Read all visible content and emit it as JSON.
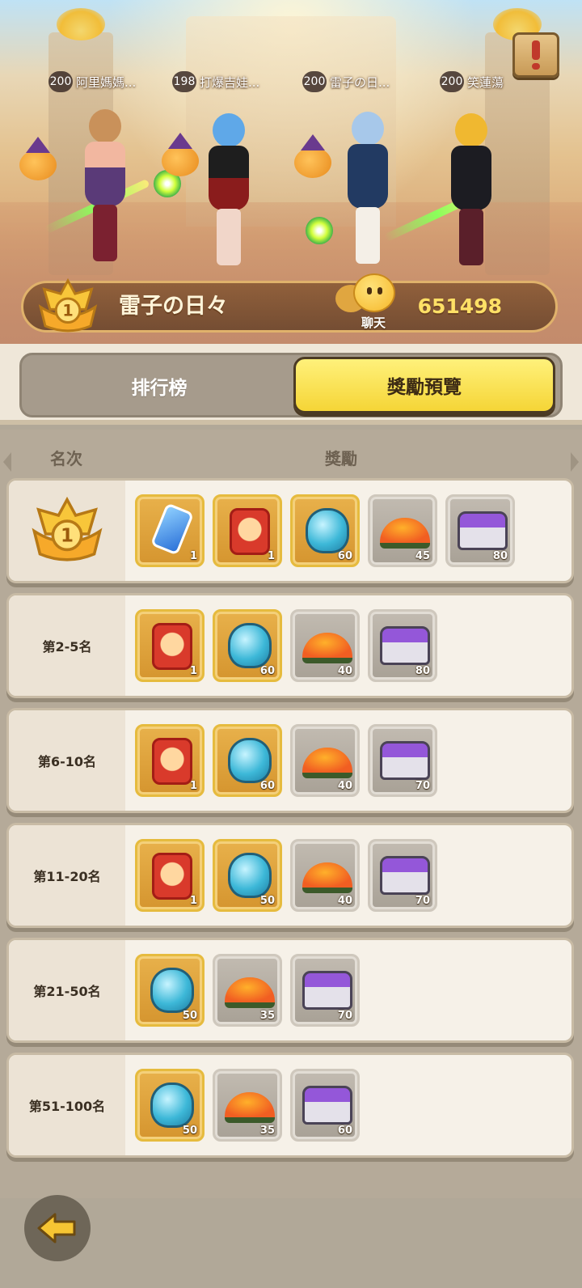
{
  "scene": {
    "players": [
      {
        "level": "200",
        "name": "阿里媽媽..."
      },
      {
        "level": "198",
        "name": "打爆吉娃..."
      },
      {
        "level": "200",
        "name": "雷子の日..."
      },
      {
        "level": "200",
        "name": "笑蓮蕩"
      }
    ],
    "champion": {
      "rank": "1",
      "name": "雷子の日々",
      "score": "651498"
    },
    "chat_label": "聊天"
  },
  "tabs": [
    {
      "label": "排行榜",
      "active": false
    },
    {
      "label": "獎勵預覽",
      "active": true
    }
  ],
  "list": {
    "col_rank": "名次",
    "col_reward": "獎勵",
    "rows": [
      {
        "rank": "1",
        "items": [
          {
            "icon": "ticket-tag-icon",
            "qty": "1",
            "frame": "gold"
          },
          {
            "icon": "red-card-icon",
            "qty": "1",
            "frame": "gold"
          },
          {
            "icon": "blue-potion-icon",
            "qty": "60",
            "frame": "gold"
          },
          {
            "icon": "food-plate-icon",
            "qty": "45",
            "frame": "grey"
          },
          {
            "icon": "purple-chest-icon",
            "qty": "80",
            "frame": "grey"
          }
        ]
      },
      {
        "rank": "第2-5名",
        "items": [
          {
            "icon": "red-card-icon",
            "qty": "1",
            "frame": "gold"
          },
          {
            "icon": "blue-potion-icon",
            "qty": "60",
            "frame": "gold"
          },
          {
            "icon": "food-plate-icon",
            "qty": "40",
            "frame": "grey"
          },
          {
            "icon": "purple-chest-icon",
            "qty": "80",
            "frame": "grey"
          }
        ]
      },
      {
        "rank": "第6-10名",
        "items": [
          {
            "icon": "red-card-icon",
            "qty": "1",
            "frame": "gold"
          },
          {
            "icon": "blue-potion-icon",
            "qty": "60",
            "frame": "gold"
          },
          {
            "icon": "food-plate-icon",
            "qty": "40",
            "frame": "grey"
          },
          {
            "icon": "purple-chest-icon",
            "qty": "70",
            "frame": "grey"
          }
        ]
      },
      {
        "rank": "第11-20名",
        "items": [
          {
            "icon": "red-card-icon",
            "qty": "1",
            "frame": "gold"
          },
          {
            "icon": "blue-potion-icon",
            "qty": "50",
            "frame": "gold"
          },
          {
            "icon": "food-plate-icon",
            "qty": "40",
            "frame": "grey"
          },
          {
            "icon": "purple-chest-icon",
            "qty": "70",
            "frame": "grey"
          }
        ]
      },
      {
        "rank": "第21-50名",
        "items": [
          {
            "icon": "blue-potion-icon",
            "qty": "50",
            "frame": "gold"
          },
          {
            "icon": "food-plate-icon",
            "qty": "35",
            "frame": "grey"
          },
          {
            "icon": "purple-chest-icon",
            "qty": "70",
            "frame": "grey"
          }
        ]
      },
      {
        "rank": "第51-100名",
        "items": [
          {
            "icon": "blue-potion-icon",
            "qty": "50",
            "frame": "gold"
          },
          {
            "icon": "food-plate-icon",
            "qty": "35",
            "frame": "grey"
          },
          {
            "icon": "purple-chest-icon",
            "qty": "60",
            "frame": "grey"
          }
        ]
      }
    ]
  },
  "colors": {
    "accent_yellow": "#f5d536",
    "gold_frame": "#e6bb3e",
    "panel": "#f6f1e8"
  }
}
